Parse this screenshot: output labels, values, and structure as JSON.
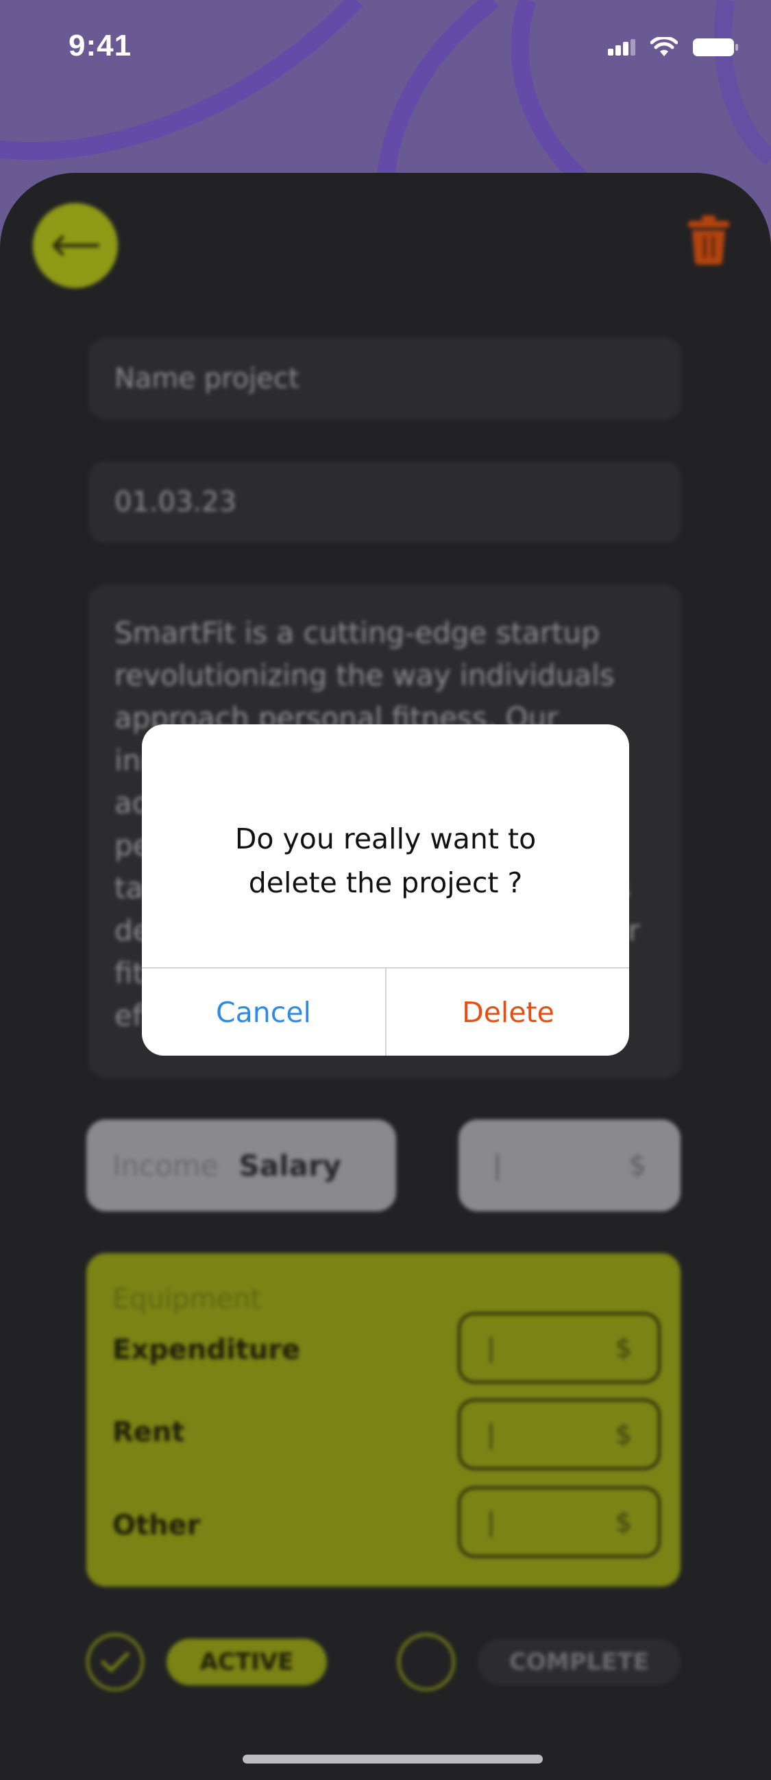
{
  "status_bar": {
    "time": "9:41"
  },
  "form": {
    "name_placeholder": "Name project",
    "date": "01.03.23",
    "description": "SmartFit is a cutting-edge startup revolutionizing the way individuals approach personal fitness. Our innovative platform combines advanced technology with personalized coaching to deliver tailored workout and nutrition plans designed to help users achieve their fitness goals efficiently and effectively."
  },
  "income": {
    "label": "Income",
    "value": "Salary",
    "amount_cursor": "|",
    "currency": "$"
  },
  "equipment": {
    "title": "Equipment",
    "rows": [
      {
        "label": "Expenditure",
        "cursor": "|",
        "currency": "$"
      },
      {
        "label": "Rent",
        "cursor": "|",
        "currency": "$"
      },
      {
        "label": "Other",
        "cursor": "|",
        "currency": "$"
      }
    ]
  },
  "status": {
    "active_label": "ACTIVE",
    "complete_label": "COMPLETE"
  },
  "dialog": {
    "line1": "Do you really want to",
    "line2": "delete the project ?",
    "cancel_label": "Cancel",
    "delete_label": "Delete"
  },
  "colors": {
    "accent_lime": "#8f9a16",
    "danger": "#e74f12",
    "link_blue": "#2f8ae3",
    "background_purple": "#6a5a93"
  }
}
